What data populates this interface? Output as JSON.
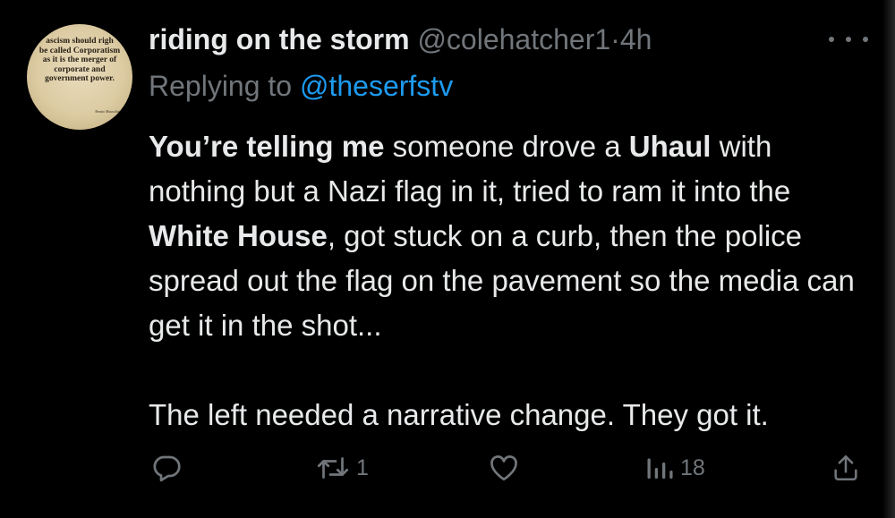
{
  "tweet": {
    "avatar": {
      "text": "ascism should righ\nbe called Corporatism\nas it is the merger of\ncorporate and\ngovernment power.",
      "signature": "Benito Mussolini"
    },
    "display_name": "riding on the storm",
    "handle": "@colehatcher1",
    "separator": "·",
    "time": "4h",
    "replying_prefix": "Replying to",
    "replying_to": "@theserfstv",
    "body": {
      "p1_bold_1": "You’re telling me",
      "p1_text_1": " someone drove a ",
      "p1_bold_2": "Uhaul",
      "p1_text_2": " with nothing but a Nazi flag in it, tried to ram it into the ",
      "p1_bold_3": "White House",
      "p1_text_3": ", got stuck on a curb, then the police spread out the flag on the pavement so the media can get it in the shot...",
      "p2": "The left needed a narrative change. They got it."
    },
    "actions": {
      "reply_icon": "reply-icon",
      "retweet_icon": "retweet-icon",
      "retweet_count": "1",
      "like_icon": "heart-icon",
      "views_icon": "views-icon",
      "views_count": "18",
      "share_icon": "share-icon"
    },
    "colors": {
      "background": "#000000",
      "text": "#e7e9ea",
      "secondary": "#71767b",
      "accent": "#1d9bf0"
    }
  }
}
